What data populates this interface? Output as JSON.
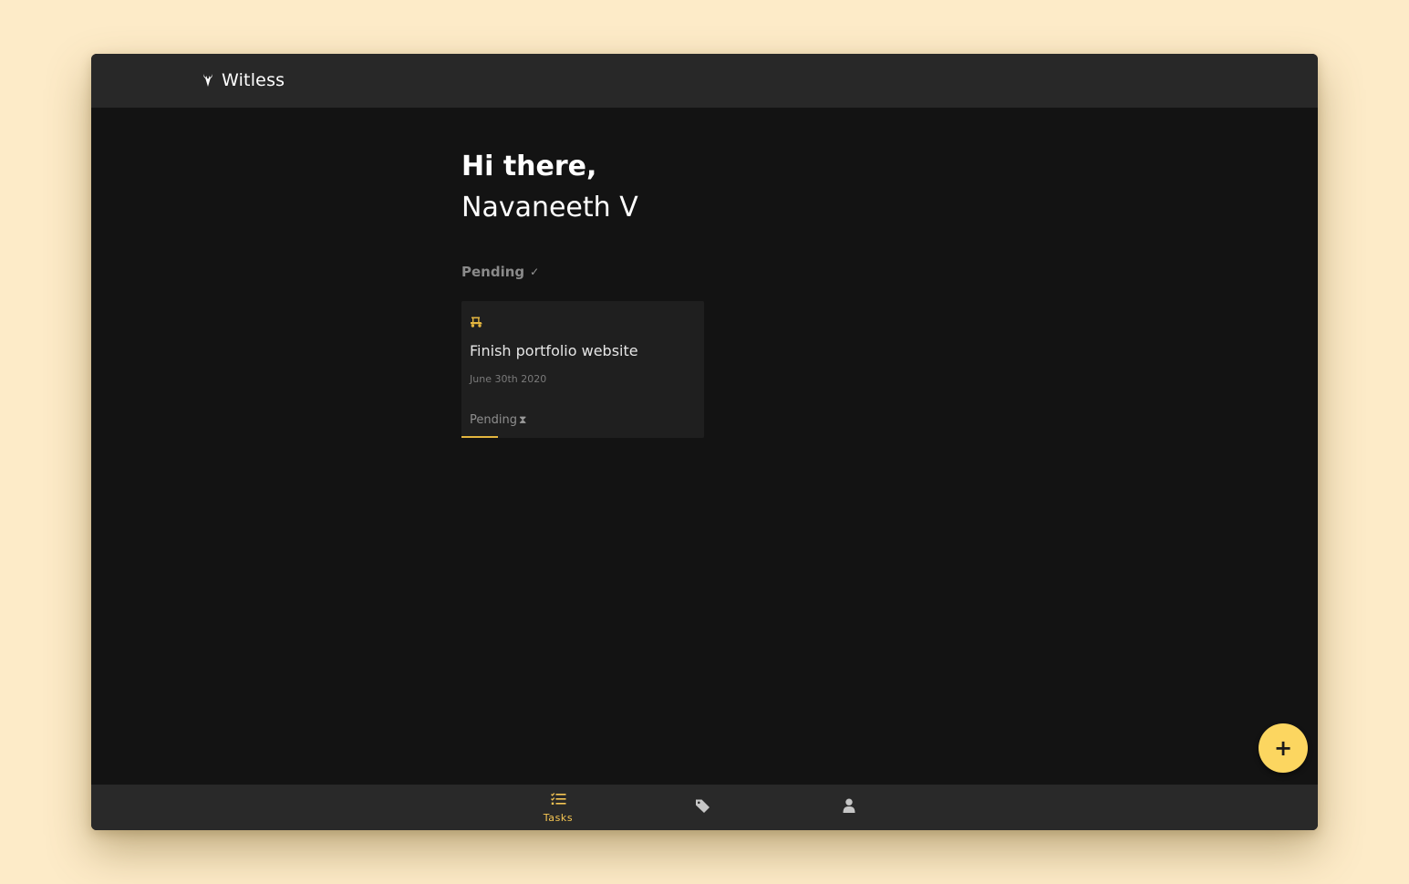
{
  "app": {
    "title": "Witless",
    "brand_icon": "deer-antler-icon"
  },
  "greeting": {
    "line1": "Hi there,",
    "line2": "Navaneeth V"
  },
  "section": {
    "label": "Pending",
    "icon": "check-icon"
  },
  "tasks": [
    {
      "icon": "golf-cart-icon",
      "title": "Finish portfolio website",
      "date": "June 30th 2020",
      "status": "Pending",
      "status_icon": "hourglass-icon",
      "progress": 0.15
    }
  ],
  "fab": {
    "label": "+",
    "icon": "plus-icon"
  },
  "bottom_nav": {
    "items": [
      {
        "label": "Tasks",
        "icon": "tasks-list-icon",
        "active": true
      },
      {
        "label": "",
        "icon": "tag-icon",
        "active": false
      },
      {
        "label": "",
        "icon": "user-icon",
        "active": false
      }
    ]
  },
  "colors": {
    "page_background": "#fdebc8",
    "app_background": "#131313",
    "bar_background": "#282828",
    "card_background": "#1f1f1f",
    "accent": "#fcd660",
    "accent_text": "#f6c653"
  }
}
